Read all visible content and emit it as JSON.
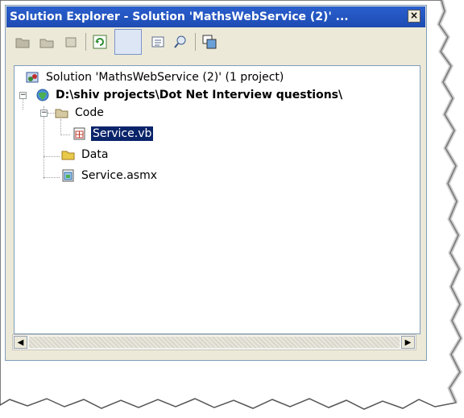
{
  "window": {
    "title": "Solution Explorer - Solution 'MathsWebService (2)' ...",
    "close_glyph": "×"
  },
  "toolbar": {
    "buttons": [
      {
        "icon": "properties-folder-icon"
      },
      {
        "icon": "show-all-files-icon"
      },
      {
        "icon": "refresh-icon"
      },
      {
        "icon": "blank-pressed-icon"
      },
      {
        "icon": "view-code-icon"
      },
      {
        "icon": "view-designer-icon"
      },
      {
        "icon": "copy-website-icon"
      }
    ]
  },
  "tree": {
    "solution": "Solution 'MathsWebService (2)' (1 project)",
    "project": "D:\\shiv projects\\Dot Net Interview questions\\",
    "folder_code": "Code",
    "file_service_vb": "Service.vb",
    "folder_data": "Data",
    "file_service_asmx": "Service.asmx",
    "expander_minus": "−"
  },
  "scrollbar": {
    "left_arrow": "◀",
    "right_arrow": "▶"
  },
  "colors": {
    "titlebar": "#1d4bb2",
    "selection": "#0a246a",
    "chrome": "#ece9d8"
  }
}
